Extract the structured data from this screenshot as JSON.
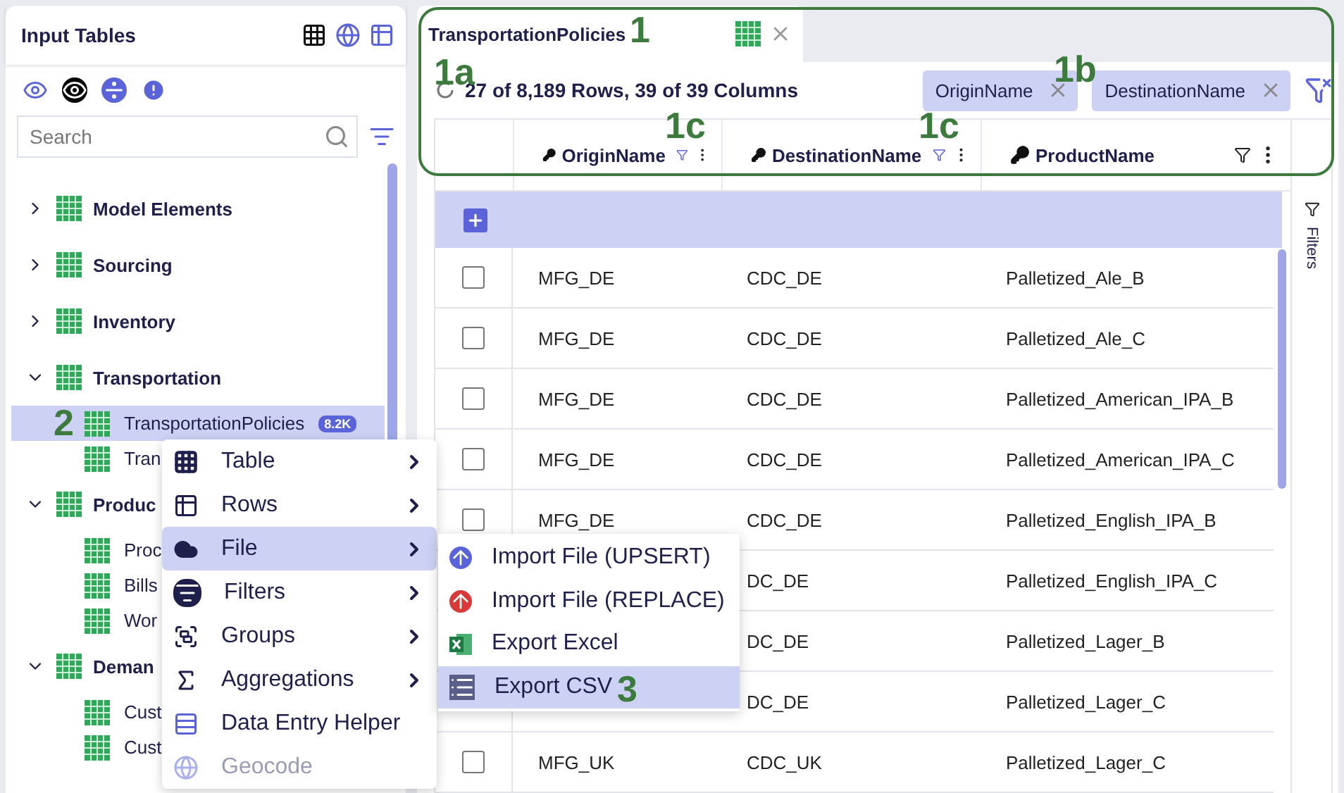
{
  "sidebar": {
    "title": "Input Tables",
    "search": {
      "placeholder": "Search"
    },
    "tree": [
      {
        "label": "Model Elements",
        "expanded": false
      },
      {
        "label": "Sourcing",
        "expanded": false
      },
      {
        "label": "Inventory",
        "expanded": false
      },
      {
        "label": "Transportation",
        "expanded": true,
        "children": [
          {
            "label": "TransportationPolicies",
            "badge": "8.2K",
            "selected": true
          },
          {
            "label": "Tran",
            "selected": false
          }
        ]
      },
      {
        "label": "Produc",
        "expanded": true,
        "children": [
          {
            "label": "Proc",
            "selected": false
          },
          {
            "label": "Bills",
            "selected": false
          },
          {
            "label": "Wor",
            "selected": false
          }
        ]
      },
      {
        "label": "Deman",
        "expanded": true,
        "children": [
          {
            "label": "Cust",
            "selected": false
          },
          {
            "label": "Cust",
            "selected": false
          }
        ]
      }
    ]
  },
  "main": {
    "tab": {
      "label": "TransportationPolicies",
      "selected": true
    },
    "summary": "27 of 8,189 Rows, 39 of 39 Columns",
    "filter_chips": [
      "OriginName",
      "DestinationName"
    ],
    "table": {
      "columns": [
        {
          "label": "OriginName",
          "filtered": true
        },
        {
          "label": "DestinationName",
          "filtered": true
        },
        {
          "label": "ProductName",
          "filtered": false
        }
      ],
      "rows": [
        {
          "checked": false,
          "cells": [
            "MFG_DE",
            "CDC_DE",
            "Palletized_Ale_B"
          ]
        },
        {
          "checked": false,
          "cells": [
            "MFG_DE",
            "CDC_DE",
            "Palletized_Ale_C"
          ]
        },
        {
          "checked": false,
          "cells": [
            "MFG_DE",
            "CDC_DE",
            "Palletized_American_IPA_B"
          ]
        },
        {
          "checked": false,
          "cells": [
            "MFG_DE",
            "CDC_DE",
            "Palletized_American_IPA_C"
          ]
        },
        {
          "checked": false,
          "cells": [
            "MFG_DE",
            "CDC_DE",
            "Palletized_English_IPA_B"
          ]
        },
        {
          "cells": [
            "",
            "DC_DE",
            "Palletized_English_IPA_C"
          ]
        },
        {
          "cells": [
            "",
            "DC_DE",
            "Palletized_Lager_B"
          ]
        },
        {
          "cells": [
            "",
            "DC_DE",
            "Palletized_Lager_C"
          ]
        },
        {
          "checked": false,
          "cells": [
            "MFG_UK",
            "CDC_UK",
            "Palletized_Lager_C"
          ]
        }
      ]
    },
    "side_rail": "Filters"
  },
  "context_menu": [
    {
      "kind": "table",
      "label": "Table",
      "submenu": true,
      "selected": false,
      "disabled": false
    },
    {
      "kind": "rows",
      "label": "Rows",
      "submenu": true,
      "selected": false,
      "disabled": false
    },
    {
      "kind": "file",
      "label": "File",
      "submenu": true,
      "selected": true,
      "disabled": false
    },
    {
      "kind": "filters",
      "label": "Filters",
      "submenu": true,
      "selected": false,
      "disabled": false
    },
    {
      "kind": "groups",
      "label": "Groups",
      "submenu": true,
      "selected": false,
      "disabled": false
    },
    {
      "kind": "aggregations",
      "label": "Aggregations",
      "submenu": true,
      "selected": false,
      "disabled": false
    },
    {
      "kind": "helper",
      "label": "Data Entry Helper",
      "submenu": false,
      "selected": false,
      "disabled": false
    },
    {
      "kind": "geocode",
      "label": "Geocode",
      "submenu": false,
      "selected": false,
      "disabled": true
    }
  ],
  "submenu": [
    {
      "kind": "upsert",
      "label": "Import File (UPSERT)",
      "selected": false
    },
    {
      "kind": "replace",
      "label": "Import File (REPLACE)",
      "selected": false
    },
    {
      "kind": "excel",
      "label": "Export Excel",
      "selected": false
    },
    {
      "kind": "csv",
      "label": "Export CSV",
      "selected": true
    }
  ],
  "annotations": [
    {
      "label": "1"
    },
    {
      "label": "1a"
    },
    {
      "label": "1b"
    },
    {
      "label": "1c"
    },
    {
      "label": "1c"
    },
    {
      "label": "2"
    },
    {
      "label": "3"
    }
  ]
}
